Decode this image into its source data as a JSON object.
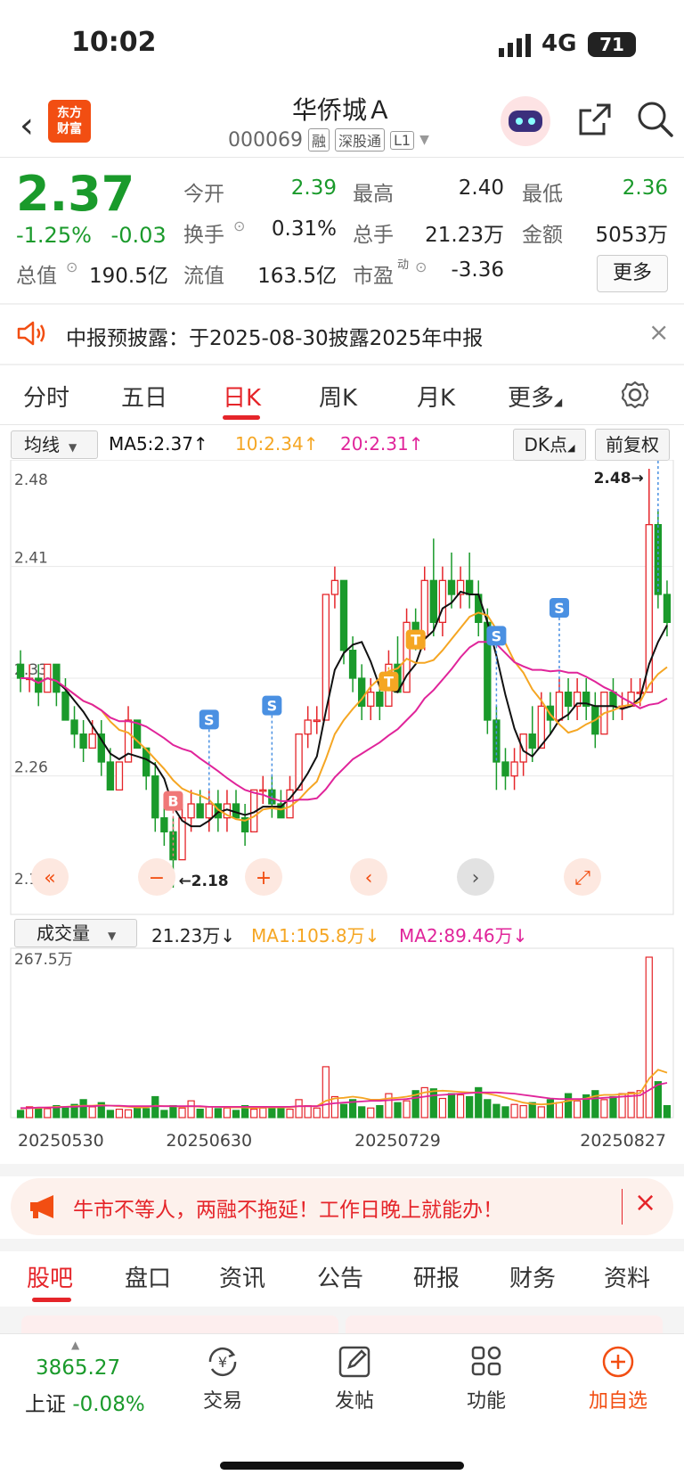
{
  "status": {
    "time": "10:02",
    "network": "4G",
    "battery": "71"
  },
  "header": {
    "title": "华侨城Ａ",
    "code": "000069",
    "tags": [
      "融",
      "深股通",
      "L1"
    ],
    "logo_line1": "东方",
    "logo_line2": "财富"
  },
  "quote": {
    "price": "2.37",
    "change_pct": "-1.25%",
    "change": "-0.03",
    "open_label": "今开",
    "open": "2.39",
    "high_label": "最高",
    "high": "2.40",
    "low_label": "最低",
    "low": "2.36",
    "turnover_label": "换手",
    "turnover": "0.31%",
    "volume_label": "总手",
    "volume": "21.23万",
    "amount_label": "金额",
    "amount": "5053万",
    "mktcap_label": "总值",
    "mktcap": "190.5亿",
    "float_label": "流值",
    "float": "163.5亿",
    "pe_label": "市盈",
    "pe_sup": "动",
    "pe": "-3.36",
    "more_label": "更多"
  },
  "notice": {
    "text": "中报预披露：于2025-08-30披露2025年中报"
  },
  "ktabs": [
    {
      "label": "分时"
    },
    {
      "label": "五日"
    },
    {
      "label": "日K"
    },
    {
      "label": "周K"
    },
    {
      "label": "月K"
    },
    {
      "label": "更多"
    }
  ],
  "main_ind": {
    "select": "均线",
    "ma5": "MA5:2.37↑",
    "ma10": "10:2.34↑",
    "ma20": "20:2.31↑",
    "dk": "DK点",
    "adjust": "前复权"
  },
  "vol_ind": {
    "select": "成交量",
    "vol": "21.23万↓",
    "ma1": "MA1:105.8万↓",
    "ma2": "MA2:89.46万↓"
  },
  "chart_data": {
    "type": "candlestick",
    "y_ticks": [
      "2.48",
      "2.41",
      "2.33",
      "2.26",
      "2.18"
    ],
    "ylim": [
      2.18,
      2.48
    ],
    "high_mark": "2.48→",
    "low_mark": "←2.18",
    "vol_max_label": "267.5万",
    "x_ticks": [
      "20250530",
      "20250630",
      "20250729",
      "20250827"
    ],
    "colors": {
      "up": "#e5252a",
      "down": "#1a9a2b",
      "ma5": "#111111",
      "ma10": "#f5a623",
      "ma20": "#e0249a"
    },
    "candles": [
      [
        2.34,
        2.35,
        2.32,
        2.33
      ],
      [
        2.33,
        2.34,
        2.32,
        2.33
      ],
      [
        2.33,
        2.34,
        2.31,
        2.32
      ],
      [
        2.32,
        2.34,
        2.32,
        2.34
      ],
      [
        2.34,
        2.34,
        2.31,
        2.32
      ],
      [
        2.32,
        2.33,
        2.3,
        2.3
      ],
      [
        2.3,
        2.31,
        2.28,
        2.29
      ],
      [
        2.29,
        2.3,
        2.27,
        2.28
      ],
      [
        2.28,
        2.3,
        2.28,
        2.29
      ],
      [
        2.29,
        2.3,
        2.26,
        2.27
      ],
      [
        2.27,
        2.28,
        2.25,
        2.25
      ],
      [
        2.25,
        2.27,
        2.25,
        2.27
      ],
      [
        2.27,
        2.31,
        2.27,
        2.3
      ],
      [
        2.3,
        2.3,
        2.28,
        2.28
      ],
      [
        2.28,
        2.28,
        2.25,
        2.26
      ],
      [
        2.26,
        2.27,
        2.22,
        2.23
      ],
      [
        2.23,
        2.24,
        2.21,
        2.22
      ],
      [
        2.22,
        2.23,
        2.18,
        2.2
      ],
      [
        2.2,
        2.24,
        2.2,
        2.23
      ],
      [
        2.23,
        2.25,
        2.22,
        2.24
      ],
      [
        2.24,
        2.25,
        2.23,
        2.23
      ],
      [
        2.23,
        2.25,
        2.22,
        2.24
      ],
      [
        2.24,
        2.25,
        2.22,
        2.23
      ],
      [
        2.23,
        2.25,
        2.22,
        2.24
      ],
      [
        2.24,
        2.25,
        2.23,
        2.23
      ],
      [
        2.23,
        2.24,
        2.21,
        2.22
      ],
      [
        2.22,
        2.25,
        2.22,
        2.25
      ],
      [
        2.25,
        2.26,
        2.24,
        2.25
      ],
      [
        2.25,
        2.26,
        2.23,
        2.24
      ],
      [
        2.24,
        2.25,
        2.23,
        2.23
      ],
      [
        2.23,
        2.26,
        2.23,
        2.25
      ],
      [
        2.25,
        2.29,
        2.25,
        2.29
      ],
      [
        2.29,
        2.31,
        2.28,
        2.3
      ],
      [
        2.3,
        2.31,
        2.29,
        2.3
      ],
      [
        2.3,
        2.39,
        2.3,
        2.39
      ],
      [
        2.39,
        2.41,
        2.38,
        2.4
      ],
      [
        2.4,
        2.4,
        2.34,
        2.35
      ],
      [
        2.35,
        2.36,
        2.32,
        2.33
      ],
      [
        2.33,
        2.34,
        2.3,
        2.31
      ],
      [
        2.31,
        2.33,
        2.3,
        2.32
      ],
      [
        2.32,
        2.33,
        2.3,
        2.31
      ],
      [
        2.31,
        2.35,
        2.31,
        2.34
      ],
      [
        2.34,
        2.36,
        2.32,
        2.32
      ],
      [
        2.32,
        2.38,
        2.32,
        2.37
      ],
      [
        2.37,
        2.38,
        2.35,
        2.36
      ],
      [
        2.36,
        2.41,
        2.35,
        2.4
      ],
      [
        2.4,
        2.43,
        2.36,
        2.37
      ],
      [
        2.37,
        2.41,
        2.36,
        2.4
      ],
      [
        2.4,
        2.42,
        2.38,
        2.39
      ],
      [
        2.39,
        2.41,
        2.38,
        2.4
      ],
      [
        2.4,
        2.42,
        2.38,
        2.39
      ],
      [
        2.39,
        2.4,
        2.36,
        2.37
      ],
      [
        2.37,
        2.38,
        2.29,
        2.3
      ],
      [
        2.3,
        2.31,
        2.25,
        2.27
      ],
      [
        2.27,
        2.28,
        2.25,
        2.26
      ],
      [
        2.26,
        2.28,
        2.25,
        2.27
      ],
      [
        2.27,
        2.29,
        2.26,
        2.29
      ],
      [
        2.29,
        2.31,
        2.27,
        2.28
      ],
      [
        2.28,
        2.32,
        2.28,
        2.31
      ],
      [
        2.31,
        2.32,
        2.29,
        2.3
      ],
      [
        2.3,
        2.33,
        2.3,
        2.32
      ],
      [
        2.32,
        2.33,
        2.3,
        2.31
      ],
      [
        2.31,
        2.33,
        2.3,
        2.32
      ],
      [
        2.32,
        2.33,
        2.3,
        2.31
      ],
      [
        2.31,
        2.32,
        2.28,
        2.29
      ],
      [
        2.29,
        2.32,
        2.29,
        2.32
      ],
      [
        2.32,
        2.33,
        2.3,
        2.31
      ],
      [
        2.31,
        2.32,
        2.3,
        2.31
      ],
      [
        2.31,
        2.33,
        2.31,
        2.32
      ],
      [
        2.32,
        2.33,
        2.31,
        2.32
      ],
      [
        2.32,
        2.48,
        2.32,
        2.44
      ],
      [
        2.44,
        2.45,
        2.38,
        2.39
      ],
      [
        2.39,
        2.4,
        2.36,
        2.37
      ]
    ],
    "volumes": [
      12,
      18,
      14,
      15,
      20,
      16,
      22,
      30,
      18,
      25,
      12,
      14,
      13,
      18,
      15,
      35,
      12,
      20,
      16,
      28,
      14,
      18,
      15,
      16,
      12,
      20,
      14,
      16,
      15,
      18,
      14,
      30,
      20,
      16,
      85,
      35,
      22,
      30,
      18,
      16,
      20,
      40,
      25,
      28,
      45,
      50,
      48,
      32,
      40,
      38,
      35,
      50,
      30,
      22,
      18,
      22,
      20,
      25,
      18,
      30,
      25,
      40,
      28,
      38,
      45,
      30,
      35,
      40,
      42,
      45,
      268,
      60,
      20
    ],
    "ma_vol1": [
      15,
      16,
      16,
      17,
      18,
      18,
      19,
      20,
      20,
      21,
      20,
      19,
      18,
      17,
      17,
      20,
      19,
      19,
      18,
      19,
      18,
      18,
      18,
      17,
      17,
      17,
      16,
      17,
      17,
      17,
      17,
      19,
      19,
      19,
      28,
      32,
      33,
      35,
      33,
      30,
      30,
      32,
      33,
      35,
      38,
      42,
      44,
      45,
      44,
      43,
      42,
      42,
      40,
      37,
      33,
      29,
      25,
      23,
      22,
      23,
      25,
      28,
      30,
      32,
      36,
      38,
      38,
      39,
      40,
      41,
      65,
      80,
      75
    ],
    "ma_vol2": [
      16,
      16,
      17,
      17,
      17,
      18,
      18,
      19,
      19,
      20,
      20,
      20,
      19,
      19,
      19,
      19,
      19,
      19,
      19,
      19,
      19,
      18,
      18,
      18,
      18,
      18,
      18,
      18,
      18,
      18,
      18,
      19,
      19,
      19,
      22,
      24,
      25,
      26,
      27,
      28,
      28,
      29,
      30,
      31,
      33,
      35,
      37,
      38,
      39,
      40,
      41,
      42,
      42,
      42,
      41,
      40,
      38,
      36,
      34,
      32,
      31,
      31,
      31,
      31,
      32,
      33,
      34,
      35,
      36,
      37,
      46,
      55,
      58
    ],
    "signals": [
      {
        "label": "B",
        "index": 17,
        "kind": "buy"
      },
      {
        "label": "S",
        "index": 21,
        "kind": "sell"
      },
      {
        "label": "S",
        "index": 28,
        "kind": "sell"
      },
      {
        "label": "T",
        "index": 41,
        "kind": "t"
      },
      {
        "label": "T",
        "index": 44,
        "kind": "t"
      },
      {
        "label": "S",
        "index": 53,
        "kind": "sell"
      },
      {
        "label": "S",
        "index": 60,
        "kind": "sell"
      },
      {
        "label": "S",
        "index": 71,
        "kind": "sell"
      }
    ]
  },
  "chart_controls": [
    "«",
    "−",
    "+",
    "‹",
    "›",
    "⤢"
  ],
  "banner": {
    "text": "牛市不等人，两融不拖延！工作日晚上就能办！"
  },
  "btabs": [
    {
      "label": "股吧"
    },
    {
      "label": "盘口"
    },
    {
      "label": "资讯"
    },
    {
      "label": "公告"
    },
    {
      "label": "研报"
    },
    {
      "label": "财务"
    },
    {
      "label": "资料"
    }
  ],
  "nav": {
    "index_value": "3865.27",
    "index_name": "上证",
    "index_change": "-0.08%",
    "items": [
      {
        "label": "交易"
      },
      {
        "label": "发帖"
      },
      {
        "label": "功能"
      },
      {
        "label": "加自选"
      }
    ]
  }
}
